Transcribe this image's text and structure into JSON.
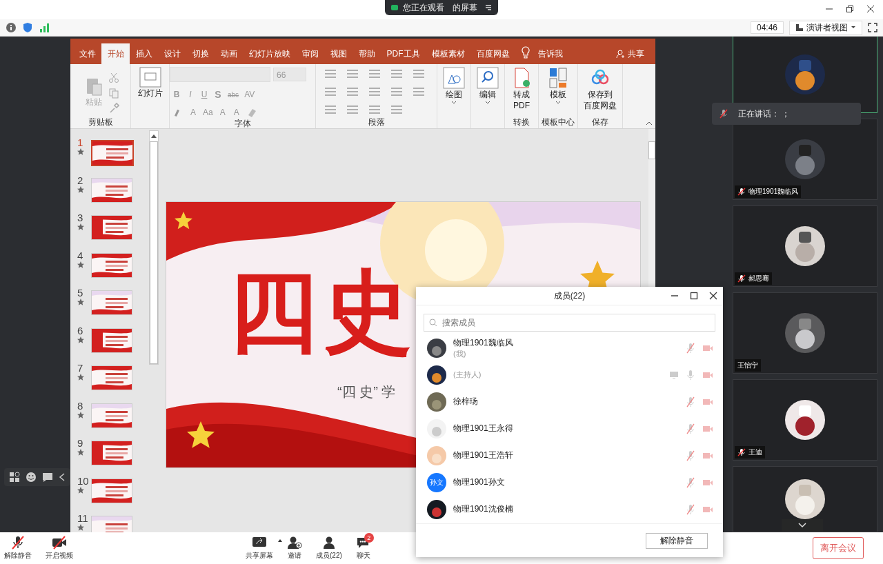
{
  "top_bar": {
    "viewing_prefix": "您正在观看",
    "viewing_suffix": "的屏幕"
  },
  "info_bar": {
    "timer": "04:46",
    "view_mode": "演讲者视图"
  },
  "ppt": {
    "tabs": [
      {
        "label": "文件",
        "selected": false
      },
      {
        "label": "开始",
        "selected": true
      },
      {
        "label": "插入",
        "selected": false
      },
      {
        "label": "设计",
        "selected": false
      },
      {
        "label": "切换",
        "selected": false
      },
      {
        "label": "动画",
        "selected": false
      },
      {
        "label": "幻灯片放映",
        "selected": false
      },
      {
        "label": "审阅",
        "selected": false
      },
      {
        "label": "视图",
        "selected": false
      },
      {
        "label": "帮助",
        "selected": false
      },
      {
        "label": "PDF工具",
        "selected": false
      },
      {
        "label": "模板素材",
        "selected": false
      },
      {
        "label": "百度网盘",
        "selected": false
      }
    ],
    "tell_me": "告诉我",
    "share": "共享",
    "ribbon": {
      "paste": {
        "label": "粘贴",
        "disabled": true
      },
      "clipboard_label": "剪贴板",
      "new_slide": "幻灯片",
      "font_size": "66",
      "font_buttons": [
        "B",
        "I",
        "U",
        "S",
        "abc",
        "AV"
      ],
      "font_buttons_2": [
        "A",
        "Aa",
        "A",
        "A"
      ],
      "font_label": "字体",
      "paragraph_label": "段落",
      "big_buttons": [
        {
          "kind": "draw",
          "lines": [
            "绘图"
          ],
          "caret": true
        },
        {
          "kind": "edit",
          "lines": [
            "编辑"
          ],
          "caret": true
        },
        {
          "kind": "pdf",
          "lines": [
            "转成",
            "PDF"
          ],
          "caret": false,
          "group_label": "转换"
        },
        {
          "kind": "template",
          "lines": [
            "模板"
          ],
          "caret": true,
          "group_label": "模板中心"
        },
        {
          "kind": "cloud",
          "lines": [
            "保存到",
            "百度网盘"
          ],
          "caret": false,
          "group_label": "保存"
        }
      ]
    },
    "slides": [
      {
        "number": "1",
        "selected": true
      },
      {
        "number": "2",
        "selected": false
      },
      {
        "number": "3",
        "selected": false
      },
      {
        "number": "4",
        "selected": false
      },
      {
        "number": "5",
        "selected": false
      },
      {
        "number": "6",
        "selected": false
      },
      {
        "number": "7",
        "selected": false
      },
      {
        "number": "8",
        "selected": false
      },
      {
        "number": "9",
        "selected": false
      },
      {
        "number": "10",
        "selected": false
      },
      {
        "number": "11",
        "selected": false
      }
    ],
    "slide": {
      "title": "四史",
      "subtitle": "“四 史” 学"
    }
  },
  "video_tiles": [
    {
      "active": true
    },
    {
      "name": "物理1901魏临风",
      "mic_muted": true,
      "active": false
    },
    {
      "name": "郝思骞",
      "mic_muted": true,
      "active": false
    },
    {
      "name": "王怡宁",
      "mic_muted": false,
      "active": false
    },
    {
      "name": "王迪",
      "mic_muted": true,
      "active": false
    },
    {
      "active": false
    }
  ],
  "speaking": {
    "text": "正在讲话： ；"
  },
  "members_dialog": {
    "title": "成员(22)",
    "search": {
      "placeholder": "搜索成员"
    },
    "members": [
      {
        "name": "物理1901魏临风",
        "note": "(我)",
        "mic_muted": true,
        "sharing": false
      },
      {
        "note": "(主持人)",
        "mic_muted": false,
        "sharing": true
      },
      {
        "name": "徐梓玚",
        "mic_muted": true,
        "sharing": false
      },
      {
        "name": "物理1901王永得",
        "mic_muted": true,
        "sharing": false
      },
      {
        "name": "物理1901王浩轩",
        "mic_muted": true,
        "sharing": false
      },
      {
        "name": "物理1901孙文",
        "avatar_text": "孙文",
        "mic_muted": true,
        "sharing": false
      },
      {
        "name": "物理1901沈俊楠",
        "mic_muted": true,
        "sharing": false
      }
    ],
    "unmute_button": "解除静音"
  },
  "bottom_bar": {
    "left": [
      {
        "kind": "mic",
        "label": "解除静音",
        "muted": true
      },
      {
        "kind": "video",
        "label": "开启视频",
        "muted": true
      }
    ],
    "center": [
      {
        "kind": "share",
        "label": "共享屏幕",
        "caret": true
      },
      {
        "kind": "invite",
        "label": "邀请",
        "caret": false
      },
      {
        "kind": "members",
        "label": "成员(22)",
        "caret": false
      },
      {
        "kind": "chat",
        "label": "聊天",
        "caret": false,
        "badge": "2"
      }
    ],
    "leave": "离开会议"
  }
}
